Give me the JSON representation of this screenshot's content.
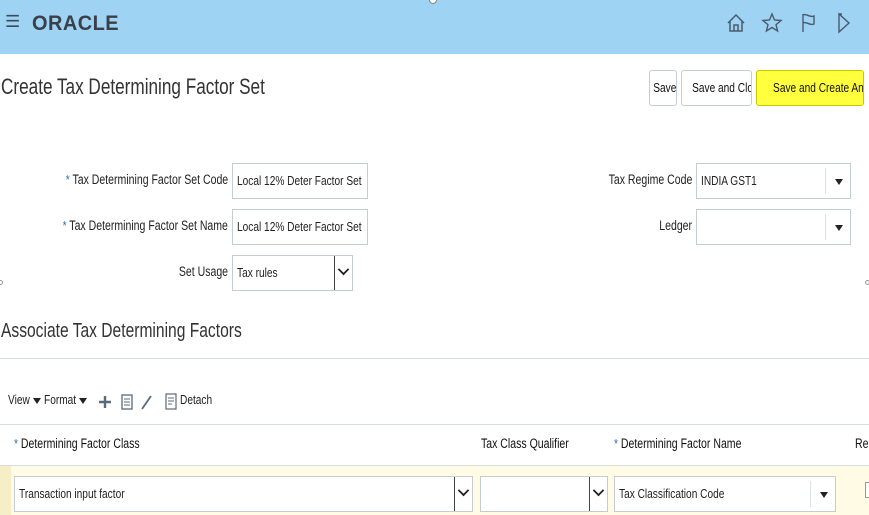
{
  "app": {
    "logo_text": "ORACLE",
    "menu_icon": "hamburger-icon",
    "header_icons": [
      "home-icon",
      "star-icon",
      "flag-icon",
      "notification-icon"
    ]
  },
  "page": {
    "title": "Create Tax Determining Factor Set",
    "buttons": {
      "save": "Save",
      "save_and_close": "Save and Close",
      "save_and_create_another": "Save and Create Another"
    }
  },
  "form": {
    "code_label": "Tax Determining Factor Set Code",
    "code_value": "Local 12% Deter Factor Set",
    "name_label": "Tax Determining Factor Set Name",
    "name_value": "Local 12% Deter Factor Set",
    "usage_label": "Set Usage",
    "usage_value": "Tax rules",
    "regime_label": "Tax Regime Code",
    "regime_value": "INDIA GST1",
    "ledger_label": "Ledger",
    "ledger_value": ""
  },
  "section": {
    "title": "Associate Tax Determining Factors",
    "toolbar": {
      "view": "View",
      "format": "Format",
      "detach": "Detach"
    },
    "table": {
      "headers": [
        "Determining Factor Class",
        "Tax Class Qualifier",
        "Determining Factor Name",
        "Req"
      ],
      "rows": [
        {
          "factor_class": "Transaction input factor",
          "qualifier": "",
          "factor_name": "Tax Classification Code"
        }
      ]
    }
  },
  "colors": {
    "header_bg": "#9fd3f3",
    "primary_button": "#ffff3d",
    "required_star": "#2a6db5"
  }
}
